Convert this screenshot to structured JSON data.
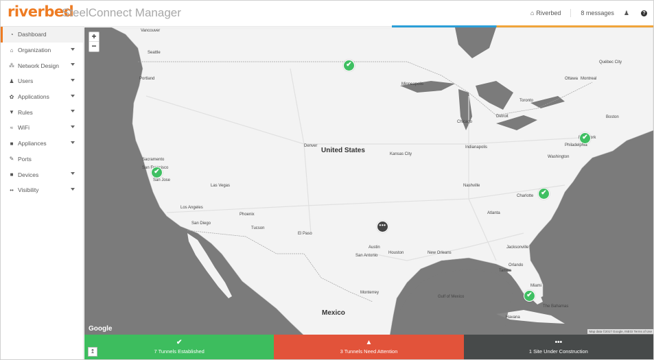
{
  "header": {
    "brand": "riverbed",
    "product": "SteelConnect Manager",
    "org_label": "Riverbed",
    "messages_label": "8 messages",
    "icons": [
      "org-icon",
      "messages-icon",
      "user-icon",
      "help-icon"
    ]
  },
  "sidebar": {
    "items": [
      {
        "label": "Dashboard",
        "icon": "dashboard-icon",
        "glyph": "◔",
        "expandable": false,
        "active": true
      },
      {
        "label": "Organization",
        "icon": "organization-icon",
        "glyph": "⌂",
        "expandable": true
      },
      {
        "label": "Network Design",
        "icon": "network-design-icon",
        "glyph": "⁂",
        "expandable": true
      },
      {
        "label": "Users",
        "icon": "users-icon",
        "glyph": "♟",
        "expandable": true
      },
      {
        "label": "Applications",
        "icon": "applications-icon",
        "glyph": "✿",
        "expandable": true
      },
      {
        "label": "Rules",
        "icon": "rules-icon",
        "glyph": "▼",
        "expandable": true
      },
      {
        "label": "WiFi",
        "icon": "wifi-icon",
        "glyph": "≈",
        "expandable": true
      },
      {
        "label": "Appliances",
        "icon": "appliances-icon",
        "glyph": "■",
        "expandable": true
      },
      {
        "label": "Ports",
        "icon": "ports-icon",
        "glyph": "✎",
        "expandable": false
      },
      {
        "label": "Devices",
        "icon": "devices-icon",
        "glyph": "■",
        "expandable": true
      },
      {
        "label": "Visibility",
        "icon": "visibility-icon",
        "glyph": "••",
        "expandable": true
      }
    ]
  },
  "map": {
    "zoom_in": "+",
    "zoom_out": "−",
    "google": "Google",
    "attribution": "Map data ©2017 Google, INEGI  Terms of Use",
    "labels": {
      "united_states": "United States",
      "mexico": "Mexico",
      "vancouver": "Vancouver",
      "seattle": "Seattle",
      "portland": "Portland",
      "sacramento": "Sacramento",
      "san_francisco": "San Francisco",
      "san_jose": "San Jose",
      "las_vegas": "Las Vegas",
      "los_angeles": "Los Angeles",
      "san_diego": "San Diego",
      "phoenix": "Phoenix",
      "tucson": "Tucson",
      "el_paso": "El Paso",
      "denver": "Denver",
      "kansas_city": "Kansas City",
      "minneapolis": "Minneapolis",
      "chicago": "Chicago",
      "detroit": "Detroit",
      "toronto": "Toronto",
      "ottawa": "Ottawa",
      "montreal": "Montreal",
      "quebec_city": "Québec City",
      "boston": "Boston",
      "new_york": "New York",
      "philadelphia": "Philadelphia",
      "washington": "Washington",
      "indianapolis": "Indianapolis",
      "nashville": "Nashville",
      "charlotte": "Charlotte",
      "atlanta": "Atlanta",
      "austin": "Austin",
      "san_antonio": "San Antonio",
      "houston": "Houston",
      "new_orleans": "New Orleans",
      "jacksonville": "Jacksonville",
      "orlando": "Orlando",
      "tampa": "Tampa",
      "miami": "Miami",
      "monterrey": "Monterrey",
      "gulf_of_mexico": "Gulf of Mexico",
      "havana": "Havana",
      "the_bahamas": "The Bahamas"
    },
    "markers": [
      {
        "name": "site-marker-north-dakota",
        "status": "established",
        "glyph": "✔"
      },
      {
        "name": "site-marker-san-francisco",
        "status": "established",
        "glyph": "✔"
      },
      {
        "name": "site-marker-new-york",
        "status": "established",
        "glyph": "✔"
      },
      {
        "name": "site-marker-charlotte",
        "status": "established",
        "glyph": "✔"
      },
      {
        "name": "site-marker-miami",
        "status": "established",
        "glyph": "✔"
      },
      {
        "name": "site-marker-texas",
        "status": "construction",
        "glyph": "•••"
      }
    ]
  },
  "status_bar": {
    "pin_glyph": "↥",
    "established": {
      "label": "7 Tunnels Established",
      "glyph": "✔",
      "color": "#3dbd5e"
    },
    "attention": {
      "label": "3 Tunnels Need Attention",
      "glyph": "▲",
      "color": "#e2533a"
    },
    "construction": {
      "label": "1 Site Under Construction",
      "glyph": "•••",
      "color": "#474a4a"
    }
  },
  "colors": {
    "brand": "#ee7b22",
    "established": "#3dbd5e",
    "attention": "#e2533a",
    "construction": "#474a4a",
    "water": "#7b7b7b",
    "land": "#f3f3f3"
  }
}
